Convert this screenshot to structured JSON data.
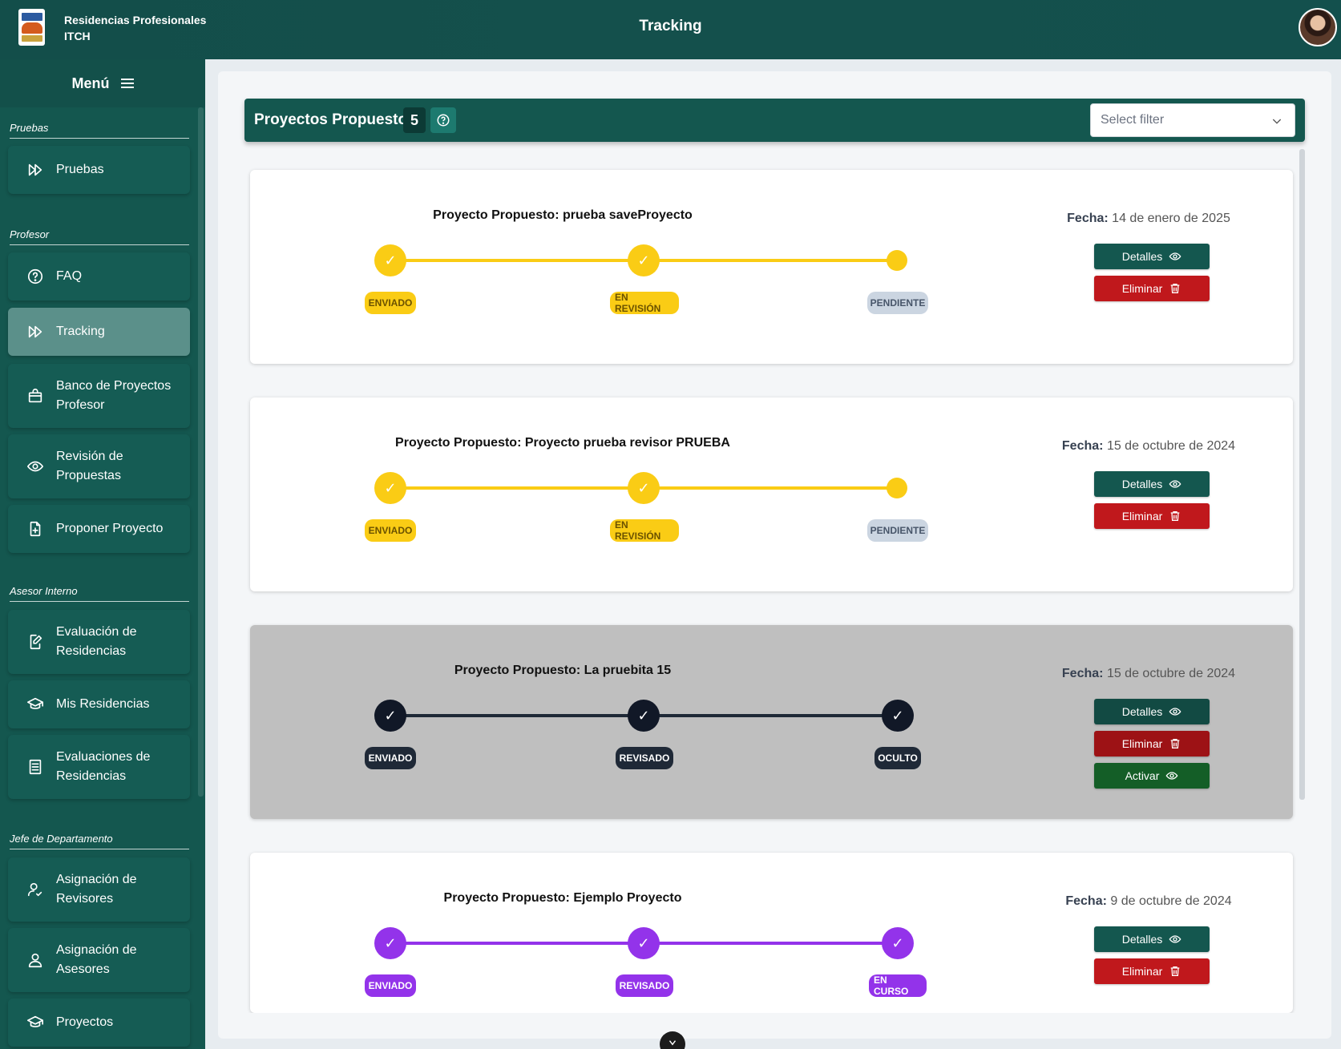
{
  "header": {
    "app_name_line1": "Residencias Profesionales",
    "app_name_line2": "ITCH",
    "page_title": "Tracking"
  },
  "sidebar": {
    "menu_label": "Menú",
    "sections": [
      {
        "label": "Pruebas"
      },
      {
        "label": "Profesor"
      },
      {
        "label": "Asesor Interno"
      },
      {
        "label": "Jefe de Departamento"
      }
    ],
    "items": [
      {
        "label": "Pruebas",
        "icon": "fast-forward-icon"
      },
      {
        "label": "FAQ",
        "icon": "help-circle-icon"
      },
      {
        "label": "Tracking",
        "icon": "fast-forward-icon",
        "active": true
      },
      {
        "label": "Banco de Proyectos Profesor",
        "icon": "briefcase-icon"
      },
      {
        "label": "Revisión de Propuestas",
        "icon": "eye-icon"
      },
      {
        "label": "Proponer Proyecto",
        "icon": "file-plus-icon"
      },
      {
        "label": "Evaluación de Residencias",
        "icon": "file-edit-icon"
      },
      {
        "label": "Mis Residencias",
        "icon": "graduation-cap-icon"
      },
      {
        "label": "Evaluaciones de Residencias",
        "icon": "document-list-icon"
      },
      {
        "label": "Asignación de Revisores",
        "icon": "user-check-icon"
      },
      {
        "label": "Asignación de Asesores",
        "icon": "user-icon"
      },
      {
        "label": "Proyectos",
        "icon": "graduation-cap-icon"
      }
    ]
  },
  "projects_header": {
    "title": "Proyectos Propuestos",
    "count": "5",
    "filter_placeholder": "Select filter"
  },
  "labels": {
    "fecha": "Fecha:",
    "detalles": "Detalles",
    "eliminar": "Eliminar",
    "activar": "Activar"
  },
  "projects": [
    {
      "title": "Proyecto Propuesto: prueba saveProyecto",
      "fecha": "14 de enero de 2025",
      "steps": [
        "ENVIADO",
        "EN REVISIÓN",
        "PENDIENTE"
      ],
      "color": "#facc15"
    },
    {
      "title": "Proyecto Propuesto: Proyecto prueba revisor PRUEBA",
      "fecha": "15 de octubre de 2024",
      "steps": [
        "ENVIADO",
        "EN REVISIÓN",
        "PENDIENTE"
      ],
      "color": "#facc15"
    },
    {
      "title": "Proyecto Propuesto: La pruebita 15",
      "fecha": "15 de octubre de 2024",
      "steps": [
        "ENVIADO",
        "REVISADO",
        "OCULTO"
      ],
      "color": "#111827"
    },
    {
      "title": "Proyecto Propuesto: Ejemplo Proyecto",
      "fecha": "9 de octubre de 2024",
      "steps": [
        "ENVIADO",
        "REVISADO",
        "EN CURSO"
      ],
      "color": "#9333ea"
    }
  ]
}
